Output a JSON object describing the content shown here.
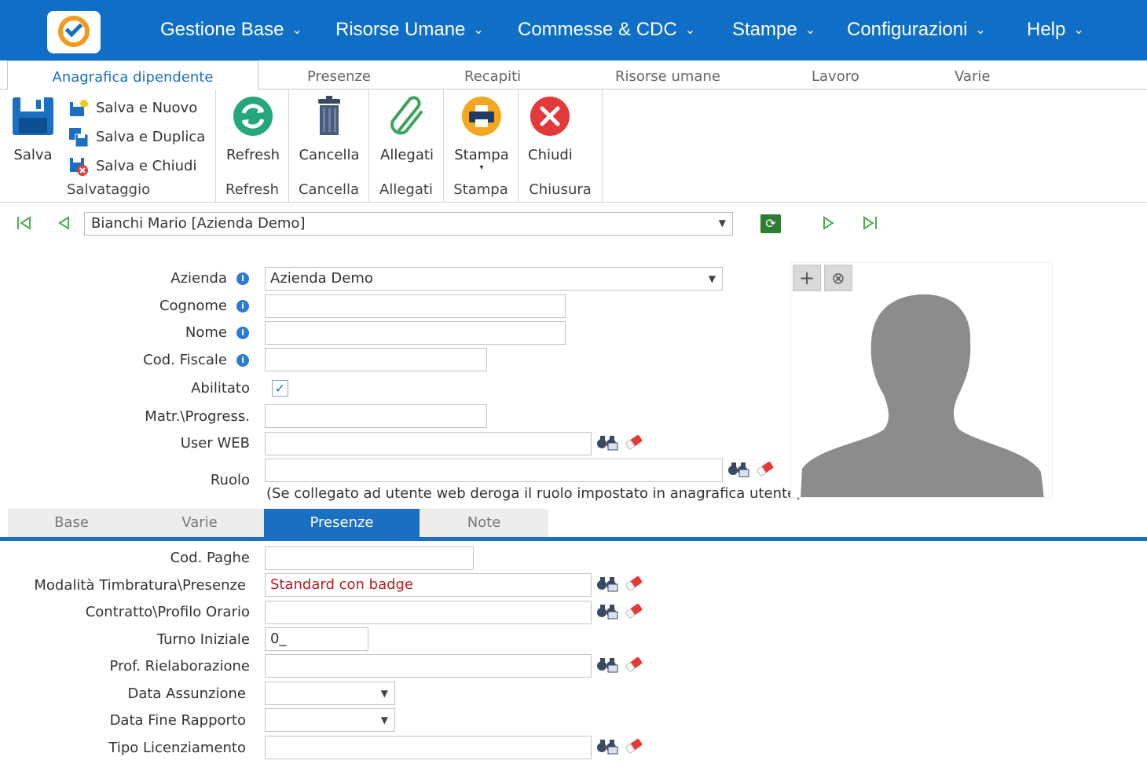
{
  "nav": {
    "items": [
      {
        "label": "Gestione Base"
      },
      {
        "label": "Risorse Umane"
      },
      {
        "label": "Commesse & CDC"
      },
      {
        "label": "Stampe"
      },
      {
        "label": "Configurazioni"
      },
      {
        "label": "Help"
      }
    ],
    "chevron": "⌄"
  },
  "ribbon_tabs": [
    "Anagrafica dipendente",
    "Presenze",
    "Recapiti",
    "Risorse umane",
    "Lavoro",
    "Varie"
  ],
  "ribbon": {
    "salva": "Salva",
    "salva_nuovo": "Salva e Nuovo",
    "salva_duplica": "Salva e Duplica",
    "salva_chiudi": "Salva e Chiudi",
    "group_salvataggio": "Salvataggio",
    "refresh": "Refresh",
    "group_refresh": "Refresh",
    "cancella": "Cancella",
    "group_cancella": "Cancella",
    "allegati": "Allegati",
    "group_allegati": "Allegati",
    "stampa": "Stampa",
    "group_stampa": "Stampa",
    "chiudi": "Chiudi",
    "group_chiusura": "Chiusura"
  },
  "record": {
    "selected": "Bianchi Mario [Azienda Demo]"
  },
  "form": {
    "azienda_label": "Azienda",
    "azienda_value": "Azienda Demo",
    "cognome_label": "Cognome",
    "nome_label": "Nome",
    "codfiscale_label": "Cod. Fiscale",
    "abilitato_label": "Abilitato",
    "abilitato_checked": true,
    "matr_label": "Matr.\\Progress.",
    "userweb_label": "User WEB",
    "ruolo_label": "Ruolo",
    "ruolo_note": "(Se collegato ad utente web deroga il ruolo impostato in anagrafica utente)"
  },
  "section_tabs": [
    "Base",
    "Varie",
    "Presenze",
    "Note"
  ],
  "presenze": {
    "codpaghe_label": "Cod. Paghe",
    "modalita_label": "Modalità Timbratura\\Presenze",
    "modalita_value": "Standard con badge",
    "contratto_label": "Contratto\\Profilo Orario",
    "turno_label": "Turno Iniziale",
    "turno_value": "0_",
    "prof_label": "Prof. Rielaborazione",
    "data_assunzione_label": "Data Assunzione",
    "data_fine_label": "Data Fine Rapporto",
    "tipo_lic_label": "Tipo Licenziamento"
  },
  "colors": {
    "brand_blue": "#0f6fc6",
    "accent_blue": "#1a6fc2",
    "refresh_green": "#26a77a",
    "close_red": "#e23a3a",
    "print_orange": "#f5a623",
    "avatar_gray": "#8c8c8c"
  }
}
